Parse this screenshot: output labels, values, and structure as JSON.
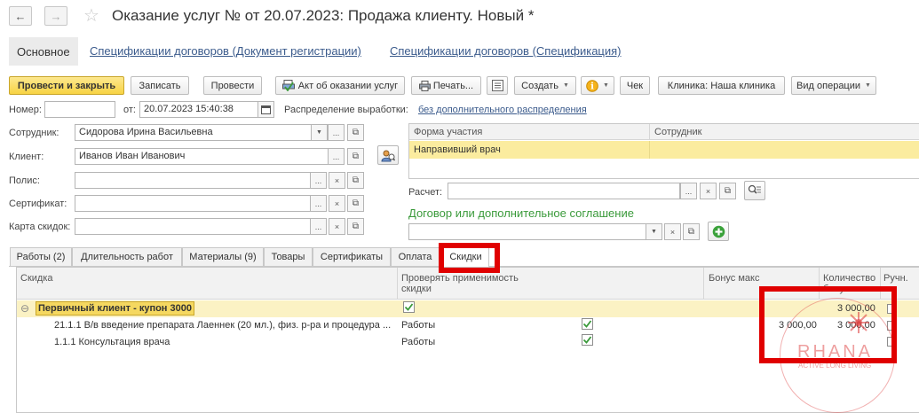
{
  "header": {
    "title": "Оказание услуг №  от 20.07.2023: Продажа клиенту.  Новый *"
  },
  "sections": {
    "active": "Основное",
    "link1": "Спецификации договоров (Документ регистрации)",
    "link2": "Спецификации договоров (Спецификация)"
  },
  "toolbar": {
    "post_close": "Провести и закрыть",
    "save": "Записать",
    "post": "Провести",
    "act": "Акт об оказании услуг",
    "print": "Печать...",
    "create": "Создать",
    "check": "Чек",
    "clinic": "Клиника: Наша клиника",
    "operation": "Вид операции"
  },
  "form": {
    "number_label": "Номер:",
    "number_value": "",
    "date_label": "от:",
    "date_value": "20.07.2023 15:40:38",
    "distribution_label": "Распределение выработки:",
    "distribution_link": "без дополнительного распределения",
    "employee_label": "Сотрудник:",
    "employee_value": "Сидорова Ирина Васильевна",
    "client_label": "Клиент:",
    "client_value": "Иванов Иван Иванович",
    "policy_label": "Полис:",
    "certificate_label": "Сертификат:",
    "discount_card_label": "Карта скидок:",
    "calc_label": "Расчет:",
    "contract_title": "Договор или дополнительное соглашение"
  },
  "participation": {
    "col1": "Форма участия",
    "col2": "Сотрудник",
    "row1": "Направивший врач"
  },
  "tabs": [
    "Работы (2)",
    "Длительность работ",
    "Материалы (9)",
    "Товары",
    "Сертификаты",
    "Оплата",
    "Скидки"
  ],
  "discounts": {
    "headers": {
      "discount": "Скидка",
      "check_line1": "Проверять применимость",
      "check_line2": "скидки",
      "bonus": "Бонус макс",
      "qty_line1": "Количество",
      "qty_line2": "бонусов",
      "manual": "Ручн."
    },
    "group": {
      "name": "Первичный клиент - купон 3000",
      "qty": "3 000,00"
    },
    "rows": [
      {
        "name": "21.1.1 В/в введение препарата Лаеннек (20 мл.), физ. р-ра  и процедура ...",
        "applicability": "Работы",
        "bonus": "3 000,00",
        "qty": "3 000,00"
      },
      {
        "name": "1.1.1 Консультация врача",
        "applicability": "Работы",
        "bonus": "",
        "qty": ""
      }
    ]
  },
  "watermark": {
    "brand": "RHANA",
    "tagline": "ACTIVE LONG LIVING"
  }
}
